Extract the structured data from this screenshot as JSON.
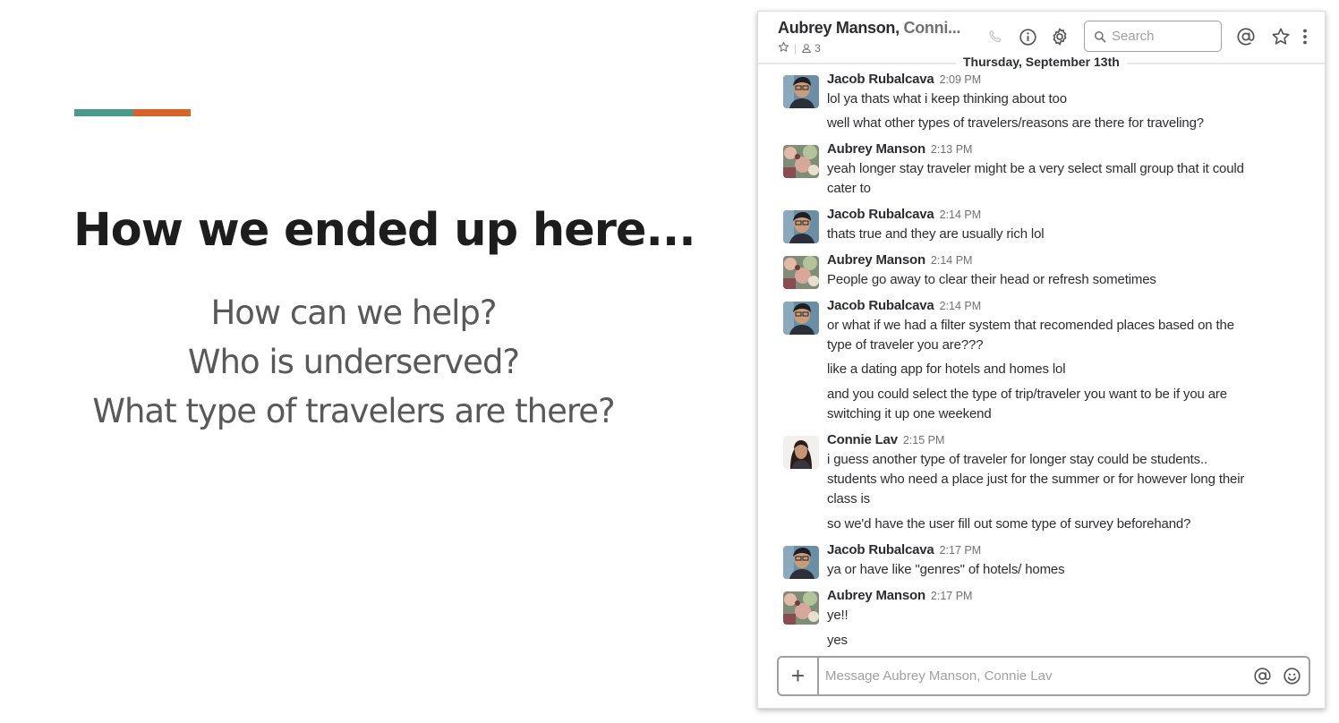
{
  "slide": {
    "title": "How we ended up here...",
    "subtitle_lines": [
      "How can we help?",
      "Who is underserved?",
      "What type of travelers are there?"
    ],
    "accent_colors": [
      "#4a9a8c",
      "#d9622b"
    ]
  },
  "slack": {
    "channel_name_bold": "Aubrey Manson, ",
    "channel_name_rest": "Conni...",
    "member_count": "3",
    "search_placeholder": "Search",
    "date_divider": "Thursday, September 13th",
    "composer_placeholder": "Message Aubrey Manson, Connie Lav",
    "add_label": "+",
    "icons": [
      "star-icon",
      "member-icon",
      "phone-icon",
      "info-icon",
      "gear-icon",
      "search-icon",
      "at-icon",
      "star-icon",
      "more-icon",
      "emoji-icon"
    ],
    "messages": [
      {
        "sender": "Jacob Rubalcava",
        "time": "2:09 PM",
        "lines": [
          "lol ya thats what i keep thinking about too",
          "well what other types of travelers/reasons are there for traveling?"
        ]
      },
      {
        "sender": "Aubrey Manson",
        "time": "2:13 PM",
        "lines": [
          "yeah longer stay traveler might be a very select small group that it could",
          "cater to"
        ]
      },
      {
        "sender": "Jacob Rubalcava",
        "time": "2:14 PM",
        "lines": [
          "thats true and they are usually rich lol"
        ]
      },
      {
        "sender": "Aubrey Manson",
        "time": "2:14 PM",
        "lines": [
          "People go away to clear their head or refresh sometimes"
        ]
      },
      {
        "sender": "Jacob Rubalcava",
        "time": "2:14 PM",
        "lines": [
          "or what if we had a filter system that recomended places based on the",
          "type of traveler you are???",
          "like a dating app for hotels and homes lol",
          "and you could select the type of trip/traveler you want to be if you are",
          "switching it up one weekend"
        ]
      },
      {
        "sender": "Connie Lav",
        "time": "2:15 PM",
        "lines": [
          "i guess another type of traveler for longer stay could be students..",
          "students who need a place just for the summer or for however long their",
          "class is",
          "so we'd have the user fill out some type of survey beforehand?"
        ]
      },
      {
        "sender": "Jacob Rubalcava",
        "time": "2:17 PM",
        "lines": [
          "ya or have like \"genres\" of hotels/ homes"
        ]
      },
      {
        "sender": "Aubrey Manson",
        "time": "2:17 PM",
        "lines": [
          "ye!!",
          "yes"
        ]
      }
    ]
  }
}
